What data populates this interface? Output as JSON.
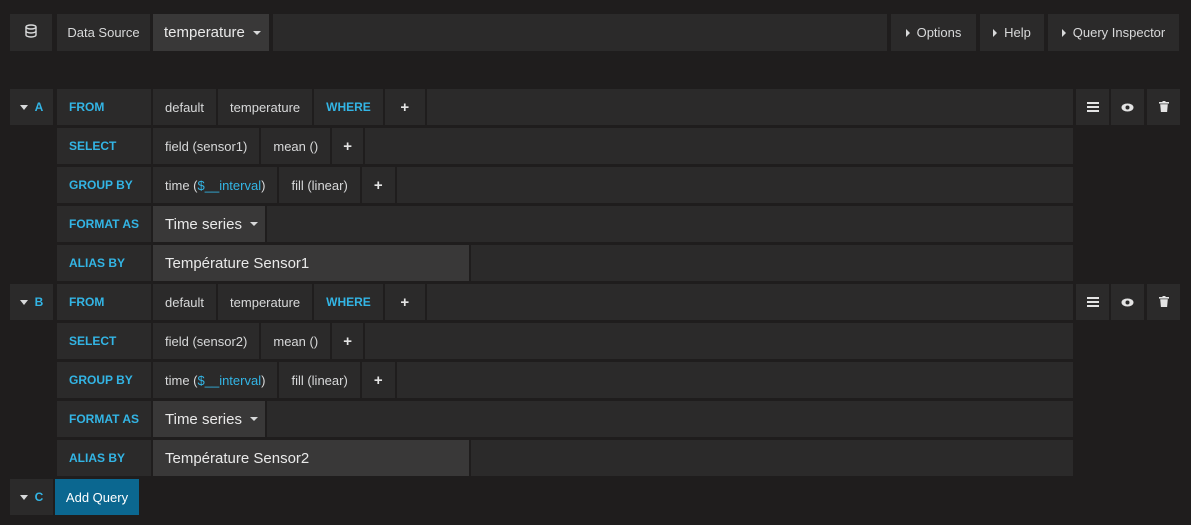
{
  "toolbar": {
    "db_icon": "database-icon",
    "data_source_label": "Data Source",
    "data_source_value": "temperature",
    "options_label": "Options",
    "help_label": "Help",
    "query_inspector_label": "Query Inspector"
  },
  "queries": [
    {
      "letter": "A",
      "from_kw": "FROM",
      "policy": "default",
      "measurement": "temperature",
      "where_kw": "WHERE",
      "select_kw": "SELECT",
      "field": "field (sensor1)",
      "func": "mean ()",
      "groupby_kw": "GROUP BY",
      "time_prefix": "time (",
      "time_var": "$__interval",
      "time_suffix": ")",
      "fill": "fill (linear)",
      "format_kw": "FORMAT AS",
      "format_value": "Time series",
      "alias_kw": "ALIAS BY",
      "alias_value": "Température Sensor1",
      "plus": "+"
    },
    {
      "letter": "B",
      "from_kw": "FROM",
      "policy": "default",
      "measurement": "temperature",
      "where_kw": "WHERE",
      "select_kw": "SELECT",
      "field": "field (sensor2)",
      "func": "mean ()",
      "groupby_kw": "GROUP BY",
      "time_prefix": "time (",
      "time_var": "$__interval",
      "time_suffix": ")",
      "fill": "fill (linear)",
      "format_kw": "FORMAT AS",
      "format_value": "Time series",
      "alias_kw": "ALIAS BY",
      "alias_value": "Température Sensor2",
      "plus": "+"
    }
  ],
  "new_query": {
    "letter": "C",
    "add_label": "Add Query"
  },
  "colors": {
    "background": "#1f1d1d",
    "panel": "#2b2a2a",
    "keyword": "#33b5e5",
    "add_button": "#0b6790"
  }
}
